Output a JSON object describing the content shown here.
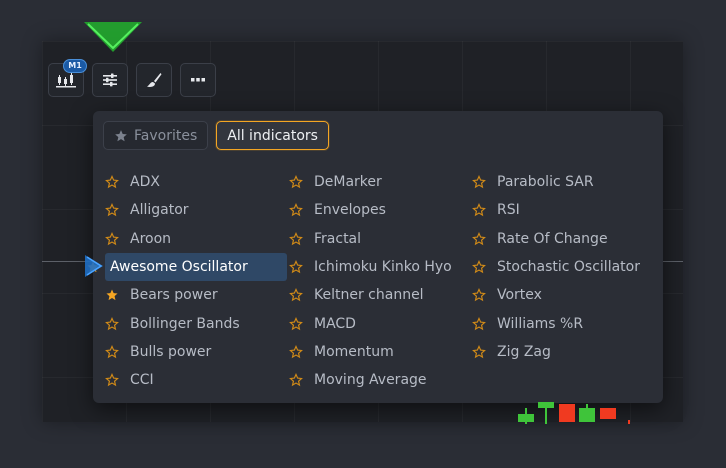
{
  "toolbar": {
    "timeframe_badge": "M1",
    "buttons": [
      {
        "icon": "candles-timeframe-icon"
      },
      {
        "icon": "sliders-icon"
      },
      {
        "icon": "brush-icon"
      },
      {
        "icon": "more-dots-icon"
      }
    ]
  },
  "panel": {
    "tabs": [
      {
        "label": "Favorites",
        "icon": "star-icon",
        "active": false
      },
      {
        "label": "All indicators",
        "active": true
      }
    ],
    "columns": [
      [
        {
          "label": "ADX",
          "favorite": false
        },
        {
          "label": "Alligator",
          "favorite": false
        },
        {
          "label": "Aroon",
          "favorite": false
        },
        {
          "label": "Awesome Oscillator",
          "favorite": true,
          "selected": true
        },
        {
          "label": "Bears power",
          "favorite": true
        },
        {
          "label": "Bollinger Bands",
          "favorite": false
        },
        {
          "label": "Bulls power",
          "favorite": false
        },
        {
          "label": "CCI",
          "favorite": false
        }
      ],
      [
        {
          "label": "DeMarker",
          "favorite": false
        },
        {
          "label": "Envelopes",
          "favorite": false
        },
        {
          "label": "Fractal",
          "favorite": false
        },
        {
          "label": "Ichimoku Kinko Hyo",
          "favorite": false
        },
        {
          "label": "Keltner channel",
          "favorite": false
        },
        {
          "label": "MACD",
          "favorite": false
        },
        {
          "label": "Momentum",
          "favorite": false
        },
        {
          "label": "Moving Average",
          "favorite": false
        }
      ],
      [
        {
          "label": "Parabolic SAR",
          "favorite": false
        },
        {
          "label": "RSI",
          "favorite": false
        },
        {
          "label": "Rate Of Change",
          "favorite": false
        },
        {
          "label": "Stochastic Oscillator",
          "favorite": false
        },
        {
          "label": "Vortex",
          "favorite": false
        },
        {
          "label": "Williams %R",
          "favorite": false
        },
        {
          "label": "Zig Zag",
          "favorite": false
        }
      ]
    ]
  },
  "colors": {
    "accent": "#f5a623",
    "selected_bg": "#2f4866",
    "pointer_green": "#2fcf3a",
    "pointer_blue": "#2b7fd6",
    "candle_up": "#3fc43a",
    "candle_down": "#f03a20"
  }
}
